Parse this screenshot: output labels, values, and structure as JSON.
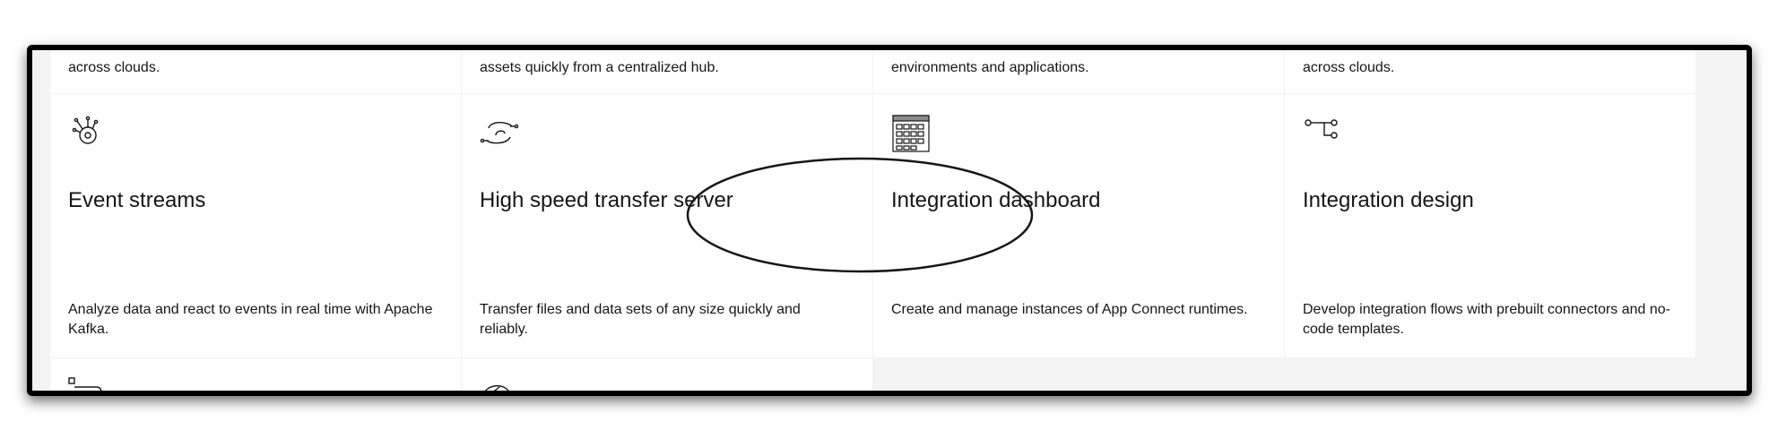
{
  "catalog": {
    "top_row": [
      "across clouds.",
      "assets quickly from a centralized hub.",
      "environments and applications.",
      "across clouds."
    ],
    "tiles": [
      {
        "title": "Event streams",
        "description": "Analyze data and react to events in real time with Apache Kafka.",
        "icon": "event-streams-icon"
      },
      {
        "title": "High speed transfer server",
        "description": "Transfer files and data sets of any size quickly and reliably.",
        "icon": "high-speed-transfer-icon"
      },
      {
        "title": "Integration dashboard",
        "description": "Create and manage instances of App Connect runtimes.",
        "icon": "dashboard-grid-icon"
      },
      {
        "title": "Integration design",
        "description": "Develop integration flows with prebuilt connectors and no-code templates.",
        "icon": "flow-connector-icon"
      }
    ],
    "bottom_row_icons": [
      "connector-partial-icon",
      "gauge-partial-icon"
    ],
    "highlighted_tile": "Integration dashboard"
  },
  "colors": {
    "tile_background": "#ffffff",
    "page_background": "#f3f3f3",
    "text": "#161616",
    "frame_border": "#000000"
  }
}
